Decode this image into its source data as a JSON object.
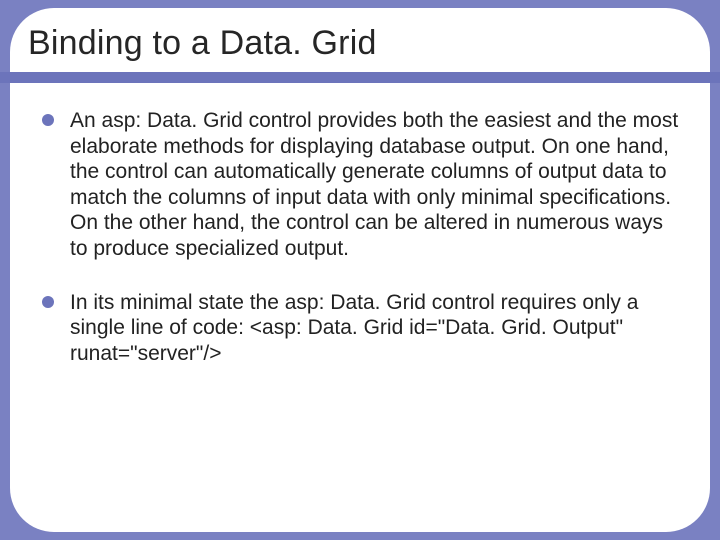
{
  "title": "Binding to a Data. Grid",
  "bullets": [
    "An asp: Data. Grid control provides both the easiest and the most elaborate methods for displaying database output. On one hand, the control can automatically generate columns of output data to match the columns of input data with only minimal specifications. On the other hand, the control can be altered in numerous ways to produce specialized output.",
    "In its minimal state the asp: Data. Grid control requires only a single line of code:\n<asp: Data. Grid id=\"Data. Grid. Output\" runat=\"server\"/>"
  ]
}
